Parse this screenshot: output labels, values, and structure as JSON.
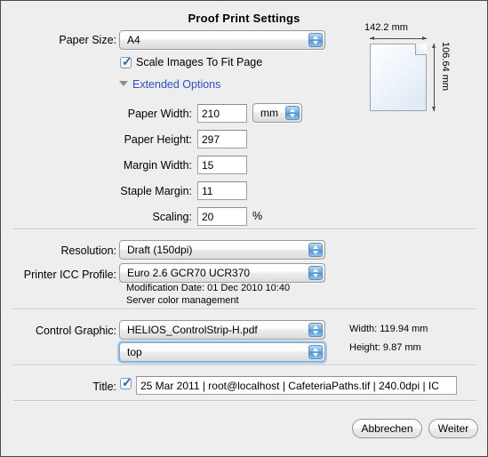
{
  "dialog": {
    "title": "Proof Print Settings"
  },
  "paper_size": {
    "label": "Paper Size:",
    "value": "A4"
  },
  "scale_images": {
    "label": "Scale Images To Fit Page",
    "checked": "✓"
  },
  "extended_options": {
    "label": "Extended Options"
  },
  "preview": {
    "width_label": "142.2 mm",
    "height_label": "106.64 mm"
  },
  "fields": [
    {
      "label": "Paper Width:",
      "value": "210"
    },
    {
      "label": "Paper Height:",
      "value": "297"
    },
    {
      "label": "Margin Width:",
      "value": "15"
    },
    {
      "label": "Staple Margin:",
      "value": "11"
    },
    {
      "label": "Scaling:",
      "value": "20"
    }
  ],
  "unit": {
    "value": "mm"
  },
  "scaling_suffix": "%",
  "resolution": {
    "label": "Resolution:",
    "value": "Draft (150dpi)"
  },
  "icc_profile": {
    "label": "Printer ICC Profile:",
    "value": "Euro 2.6 GCR70 UCR370",
    "modification_date": "Modification Date: 01 Dec 2010 10:40",
    "color_management": "Server color management"
  },
  "control_graphic": {
    "label": "Control Graphic:",
    "file_value": "HELIOS_ControlStrip-H.pdf",
    "position_value": "top",
    "width_text": "Width: 119.94 mm",
    "height_text": "Height:   9.87 mm"
  },
  "title_row": {
    "label": "Title:",
    "checked": "✓",
    "value": "25 Mar 2011 | root@localhost | CafeteriaPaths.tif | 240.0dpi | IC"
  },
  "buttons": {
    "cancel": "Abbrechen",
    "next": "Weiter"
  },
  "colors": {
    "window_bg": "#eeeeee",
    "link": "#2a4fd6",
    "accent": "#4e93d6"
  }
}
